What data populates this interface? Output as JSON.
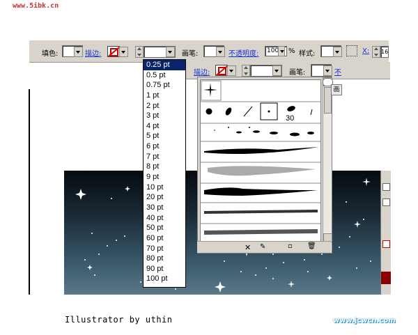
{
  "watermark_top": "www.5ibk.cn",
  "toolbar": {
    "fill_label": "填色:",
    "stroke_label": "描边:",
    "brush_label": "画笔:",
    "opacity_label": "不透明度:",
    "opacity_value": "100",
    "opacity_unit": "%",
    "style_label": "样式:",
    "x_label": "X:",
    "x_value": "16"
  },
  "toolbar2": {
    "stroke_label": "描边:",
    "brush_label": "画笔:",
    "opacity_label_partial": "不"
  },
  "stroke_weight_dropdown": {
    "selected": "0.25 pt",
    "options": [
      "0.25 pt",
      "0.5 pt",
      "0.75 pt",
      "1 pt",
      "2 pt",
      "3 pt",
      "4 pt",
      "5 pt",
      "6 pt",
      "7 pt",
      "8 pt",
      "9 pt",
      "10 pt",
      "20 pt",
      "30 pt",
      "40 pt",
      "50 pt",
      "60 pt",
      "70 pt",
      "80 pt",
      "90 pt",
      "100 pt"
    ]
  },
  "brush_panel": {
    "calligraphic_size_label": "30",
    "side_tab_label": "画"
  },
  "caption": "Illustrator by uthin",
  "watermark_bottom": "www.jcwcn.com",
  "colors": {
    "selection": "#0a246a",
    "link": "#1a32d6",
    "panel_bg": "#d8d4cc",
    "stroke_red": "#cc0000"
  }
}
